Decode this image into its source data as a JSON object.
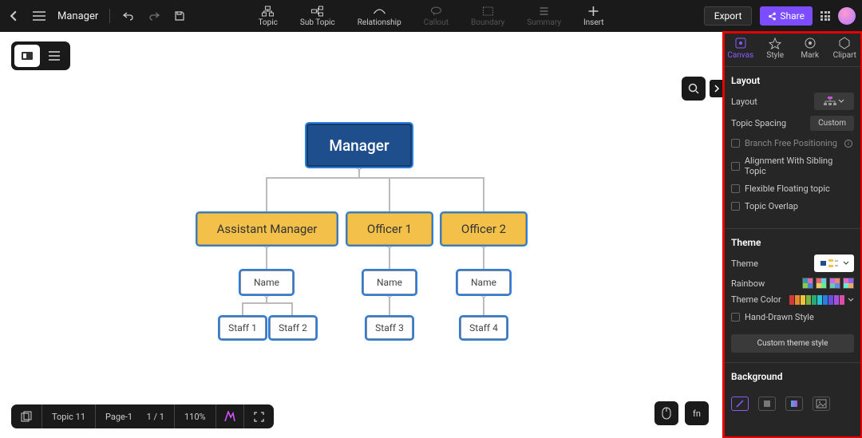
{
  "header": {
    "doc_title": "Manager",
    "tools": [
      {
        "label": "Topic"
      },
      {
        "label": "Sub Topic"
      },
      {
        "label": "Relationship"
      },
      {
        "label": "Callout"
      },
      {
        "label": "Boundary"
      },
      {
        "label": "Summary"
      },
      {
        "label": "Insert"
      }
    ],
    "export": "Export",
    "share": "Share"
  },
  "chart_data": {
    "type": "tree",
    "root": {
      "label": "Manager",
      "children": [
        {
          "label": "Assistant Manager",
          "children": [
            {
              "label": "Name",
              "children": [
                {
                  "label": "Staff 1"
                },
                {
                  "label": "Staff 2"
                }
              ]
            }
          ]
        },
        {
          "label": "Officer 1",
          "children": [
            {
              "label": "Name",
              "children": [
                {
                  "label": "Staff 3"
                }
              ]
            }
          ]
        },
        {
          "label": "Officer 2",
          "children": [
            {
              "label": "Name",
              "children": [
                {
                  "label": "Staff 4"
                }
              ]
            }
          ]
        }
      ]
    }
  },
  "nodes": {
    "root": "Manager",
    "am": "Assistant Manager",
    "o1": "Officer 1",
    "o2": "Officer 2",
    "name": "Name",
    "s1": "Staff 1",
    "s2": "Staff 2",
    "s3": "Staff 3",
    "s4": "Staff 4"
  },
  "statusbar": {
    "topic_count": "Topic 11",
    "page_label": "Page-1",
    "page_pos": "1 / 1",
    "zoom": "110%"
  },
  "panel": {
    "tabs": {
      "canvas": "Canvas",
      "style": "Style",
      "mark": "Mark",
      "clipart": "Clipart"
    },
    "layout": {
      "heading": "Layout",
      "layout_label": "Layout",
      "spacing_label": "Topic Spacing",
      "spacing_value": "Custom",
      "branch_free": "Branch Free Positioning",
      "align_sibling": "Alignment With Sibling Topic",
      "flex_float": "Flexible Floating topic",
      "overlap": "Topic Overlap"
    },
    "theme": {
      "heading": "Theme",
      "theme_label": "Theme",
      "rainbow_label": "Rainbow",
      "theme_color_label": "Theme Color",
      "hand_drawn": "Hand-Drawn Style",
      "custom_btn": "Custom theme style",
      "colors": [
        "#d23a3a",
        "#e68a2e",
        "#efc23c",
        "#7cb342",
        "#2aa876",
        "#26c2d6",
        "#2a7de1",
        "#6a4fe0",
        "#a64fe0",
        "#d94fa6"
      ]
    },
    "background": {
      "heading": "Background"
    }
  }
}
